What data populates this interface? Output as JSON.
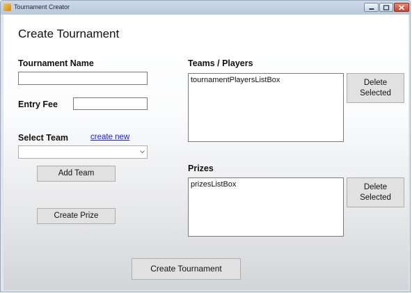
{
  "window": {
    "title": "Tournament Creator",
    "controls": [
      "minimize-icon",
      "maximize-icon",
      "close-icon"
    ]
  },
  "form": {
    "heading": "Create Tournament",
    "tournament_name_label": "Tournament Name",
    "tournament_name_value": "",
    "entry_fee_label": "Entry Fee",
    "entry_fee_value": "",
    "select_team_label": "Select Team",
    "create_new_link": "create new",
    "select_team_value": "",
    "add_team_button": "Add Team",
    "create_prize_button": "Create Prize",
    "create_tournament_button": "Create Tournament"
  },
  "teams_players": {
    "label": "Teams / Players",
    "listbox_text": "tournamentPlayersListBox",
    "delete_button": "Delete Selected"
  },
  "prizes": {
    "label": "Prizes",
    "listbox_text": "prizesListBox",
    "delete_button": "Delete Selected"
  },
  "colors": {
    "link": "#1a1ae0",
    "button_face": "#e1e1e1",
    "titlebar": "#c5d3e4",
    "close_button": "#c44630"
  }
}
